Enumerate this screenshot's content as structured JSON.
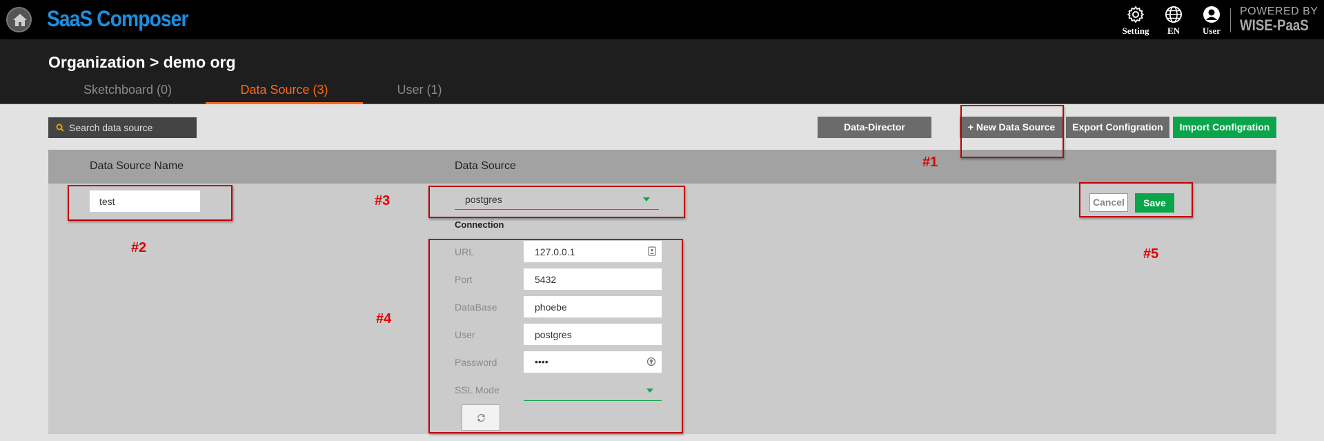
{
  "app": {
    "title": "SaaS Composer"
  },
  "topbar": {
    "setting_label": "Setting",
    "language_label": "EN",
    "user_label": "User",
    "brand_line1": "POWERED BY",
    "brand_line2": "WISE-PaaS"
  },
  "header": {
    "breadcrumb": "Organization > demo org",
    "tabs": [
      {
        "label": "Sketchboard (0)",
        "active": false
      },
      {
        "label": "Data Source (3)",
        "active": true
      },
      {
        "label": "User (1)",
        "active": false
      }
    ]
  },
  "toolbar": {
    "search_placeholder": "Search data source",
    "data_director": "Data-Director",
    "new_data_source": "+ New Data Source",
    "export_config": "Export Configration",
    "import_config": "Import Configration"
  },
  "table": {
    "col_name": "Data Source Name",
    "col_source": "Data Source"
  },
  "editor": {
    "name_value": "test",
    "source_value": "postgres",
    "connection_title": "Connection",
    "fields": [
      {
        "label": "URL",
        "value": "127.0.0.1"
      },
      {
        "label": "Port",
        "value": "5432"
      },
      {
        "label": "DataBase",
        "value": "phoebe"
      },
      {
        "label": "User",
        "value": "postgres"
      },
      {
        "label": "Password",
        "value": "••••"
      }
    ],
    "ssl_label": "SSL Mode",
    "ssl_value": "",
    "cancel": "Cancel",
    "save": "Save"
  },
  "annotations": [
    "#1",
    "#2",
    "#3",
    "#4",
    "#5"
  ],
  "colors": {
    "accent_green": "#0aa54a",
    "active_tab": "#ff6a1a",
    "title_blue": "#1b8fe0",
    "annotation_red": "#c00000"
  }
}
